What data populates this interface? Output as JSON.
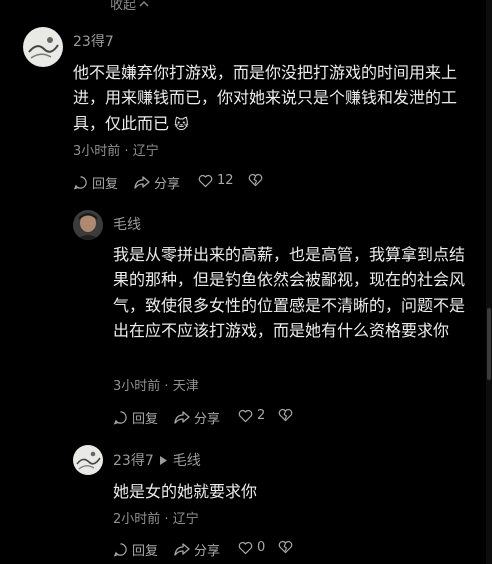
{
  "top": {
    "collapse_label": "收起"
  },
  "comments": [
    {
      "username": "23得7",
      "text": "他不是嫌弃你打游戏，而是你没把打游戏的时间用来上进，用来赚钱而已，你对她来说只是个赚钱和发泄的工具，仅此而已",
      "emoji": "🐱",
      "time": "3小时前",
      "location": "辽宁",
      "reply_label": "回复",
      "share_label": "分享",
      "likes": "12"
    },
    {
      "username": "毛线",
      "text": "我是从零拼出来的高薪，也是高管，我算拿到点结果的那种，但是钓鱼依然会被鄙视，现在的社会风气，致使很多女性的位置感是不清晰的，问题不是出在应不应该打游戏，而是她有什么资格要求你",
      "time": "3小时前",
      "location": "天津",
      "reply_label": "回复",
      "share_label": "分享",
      "likes": "2"
    },
    {
      "username": "23得7",
      "reply_to": "毛线",
      "text": "她是女的她就要求你",
      "time": "2小时前",
      "location": "辽宁",
      "reply_label": "回复",
      "share_label": "分享",
      "likes": "0"
    }
  ],
  "icons": [
    "chevron-up-icon",
    "reply-icon",
    "share-icon",
    "heart-icon",
    "dislike-heart-icon",
    "play-arrow-icon"
  ]
}
